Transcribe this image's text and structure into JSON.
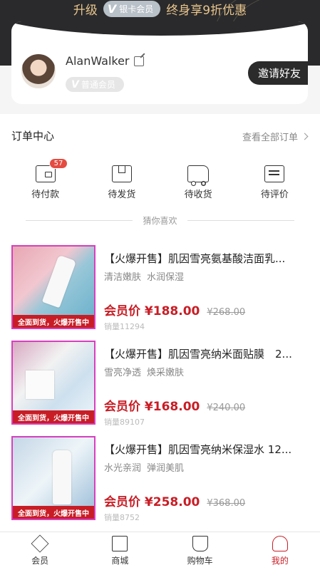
{
  "banner": {
    "prefix": "升级",
    "badge_v": "V",
    "badge": "银卡会员",
    "suffix": "终身享9折优惠"
  },
  "user": {
    "name": "AlanWalker",
    "level_v": "V",
    "level": "普通会员",
    "invite": "邀请好友"
  },
  "orders": {
    "title": "订单中心",
    "view_all": "查看全部订单",
    "items": [
      {
        "label": "待付款",
        "badge": "57"
      },
      {
        "label": "待发货"
      },
      {
        "label": "待收货"
      },
      {
        "label": "待评价"
      }
    ]
  },
  "guess": {
    "label": "猜你喜欢"
  },
  "products": [
    {
      "title": "【火爆开售】肌因雪亮氨基酸洁面乳...",
      "tags": [
        "清洁嫩肤",
        "水润保湿"
      ],
      "price": "会员价 ¥188.00",
      "old_price": "¥268.00",
      "sales": "销量11294",
      "strip": "全面到货，火爆开售中"
    },
    {
      "title": "【火爆开售】肌因雪亮纳米面贴膜　2...",
      "tags": [
        "雪亮净透",
        "焕采嫩肤"
      ],
      "price": "会员价 ¥168.00",
      "old_price": "¥240.00",
      "sales": "销量89107",
      "strip": "全面到货，火爆开售中"
    },
    {
      "title": "【火爆开售】肌因雪亮纳米保湿水 12...",
      "tags": [
        "水光亲润",
        "弹润美肌"
      ],
      "price": "会员价 ¥258.00",
      "old_price": "¥368.00",
      "sales": "销量8752",
      "strip": "全面到货，火爆开售中"
    }
  ],
  "tabbar": [
    {
      "label": "会员"
    },
    {
      "label": "商城"
    },
    {
      "label": "购物车"
    },
    {
      "label": "我的",
      "active": true
    }
  ],
  "colors": {
    "accent": "#c81d25",
    "dark": "#2a2a2c",
    "gold": "#e9c58c"
  }
}
